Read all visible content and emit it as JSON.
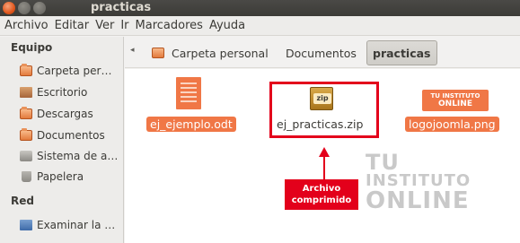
{
  "window": {
    "title": "practicas"
  },
  "menu": {
    "items": [
      "Archivo",
      "Editar",
      "Ver",
      "Ir",
      "Marcadores",
      "Ayuda"
    ]
  },
  "sidebar": {
    "sections": [
      {
        "heading": "Equipo",
        "items": [
          {
            "label": "Carpeta per…",
            "icon": "home-folder-icon"
          },
          {
            "label": "Escritorio",
            "icon": "desktop-icon"
          },
          {
            "label": "Descargas",
            "icon": "downloads-folder-icon"
          },
          {
            "label": "Documentos",
            "icon": "documents-folder-icon"
          },
          {
            "label": "Sistema de a…",
            "icon": "filesystem-icon"
          },
          {
            "label": "Papelera",
            "icon": "trash-icon"
          }
        ]
      },
      {
        "heading": "Red",
        "items": [
          {
            "label": "Examinar la …",
            "icon": "network-icon"
          }
        ]
      }
    ]
  },
  "location": {
    "crumbs": [
      "Carpeta personal",
      "Documentos",
      "practicas"
    ],
    "active_index": 2
  },
  "files": [
    {
      "name": "ej_ejemplo.odt",
      "icon": "odt-document-icon",
      "selected": true
    },
    {
      "name": "ej_practicas.zip",
      "icon": "zip-archive-icon",
      "selected": false
    },
    {
      "name": "logojoomla.png",
      "icon": "png-image-icon",
      "selected": true
    }
  ],
  "zip_icon_text": "zip",
  "logo_icon_text": {
    "line1": "TU INSTITUTO",
    "line2": "ONLINE"
  },
  "annotation": {
    "line1": "Archivo",
    "line2": "comprimido"
  },
  "watermark": {
    "line1": "TU",
    "line2": "INSTITUTO",
    "line3": "ONLINE"
  },
  "colors": {
    "accent": "#f07746",
    "annotation": "#e3001b",
    "titlebar": "#3c3b37"
  }
}
